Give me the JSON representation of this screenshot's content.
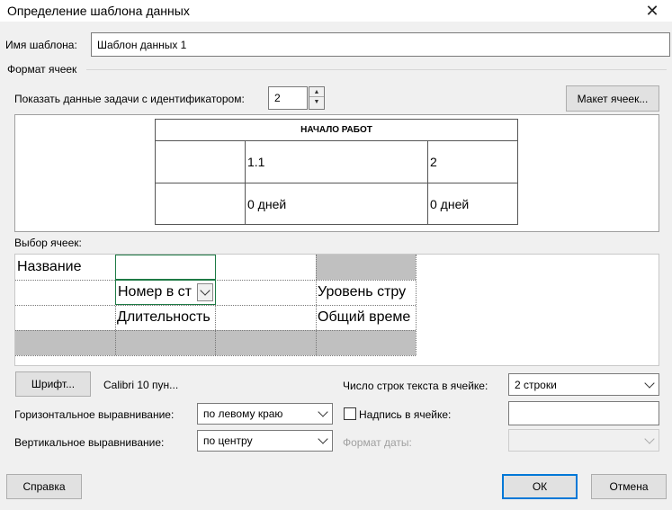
{
  "window": {
    "title": "Определение шаблона данных"
  },
  "template_name": {
    "label": "Имя шаблона:",
    "value": "Шаблон данных 1"
  },
  "cell_format": {
    "group_label": "Формат ячеек"
  },
  "show_task": {
    "label": "Показать данные задачи с идентификатором:",
    "value": "2"
  },
  "buttons": {
    "cell_layout": "Макет ячеек...",
    "font": "Шрифт...",
    "help": "Справка",
    "ok": "ОК",
    "cancel": "Отмена"
  },
  "preview": {
    "header": "НАЧАЛО РАБОТ",
    "row1": [
      "",
      "1.1",
      "2"
    ],
    "row2": [
      "",
      "0 дней",
      "0 дней"
    ]
  },
  "cell_selection": {
    "label": "Выбор ячеек:",
    "rows": [
      [
        "Название",
        "",
        "",
        ""
      ],
      [
        "",
        "Номер в ст",
        "",
        "Уровень стру"
      ],
      [
        "",
        "Длительность",
        "",
        "Общий време"
      ],
      [
        "",
        "",
        "",
        ""
      ]
    ]
  },
  "font_info": "Calibri 10 пун...",
  "text_lines": {
    "label": "Число строк текста в ячейке:",
    "value": "2 строки"
  },
  "horizontal_align": {
    "label": "Горизонтальное выравнивание:",
    "value": "по левому краю"
  },
  "vertical_align": {
    "label": "Вертикальное выравнивание:",
    "value": "по центру"
  },
  "cell_caption": {
    "label": "Надпись в ячейке:",
    "value": ""
  },
  "date_format": {
    "label": "Формат даты:",
    "value": ""
  }
}
